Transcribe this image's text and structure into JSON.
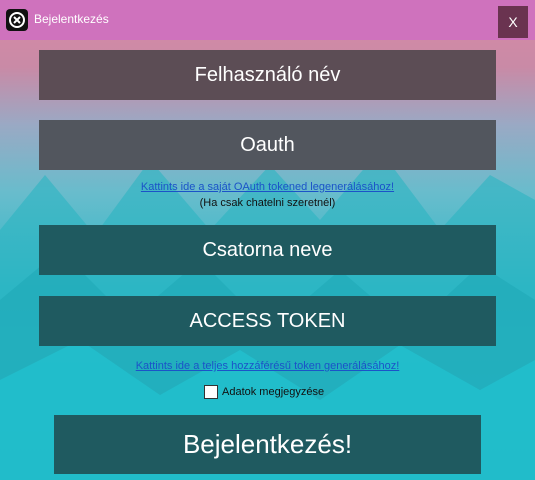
{
  "window": {
    "title": "Bejelentkezés",
    "close_label": "X"
  },
  "fields": {
    "username_placeholder": "Felhasználó név",
    "oauth_placeholder": "Oauth",
    "channel_placeholder": "Csatorna neve",
    "access_token_placeholder": "ACCESS TOKEN"
  },
  "links": {
    "oauth_link": "Kattints ide a saját OAuth tokened legenerálásához!",
    "oauth_hint": "(Ha csak chatelni szeretnél)",
    "full_token_link": "Kattints ide a teljes hozzáférésű token generálásához!"
  },
  "remember": {
    "label": "Adatok megjegyzése",
    "checked": false
  },
  "login": {
    "label": "Bejelentkezés!"
  },
  "colors": {
    "titlebar": "#cf72bd",
    "field_dark": "#1f5a60",
    "link": "#1b53c8"
  }
}
